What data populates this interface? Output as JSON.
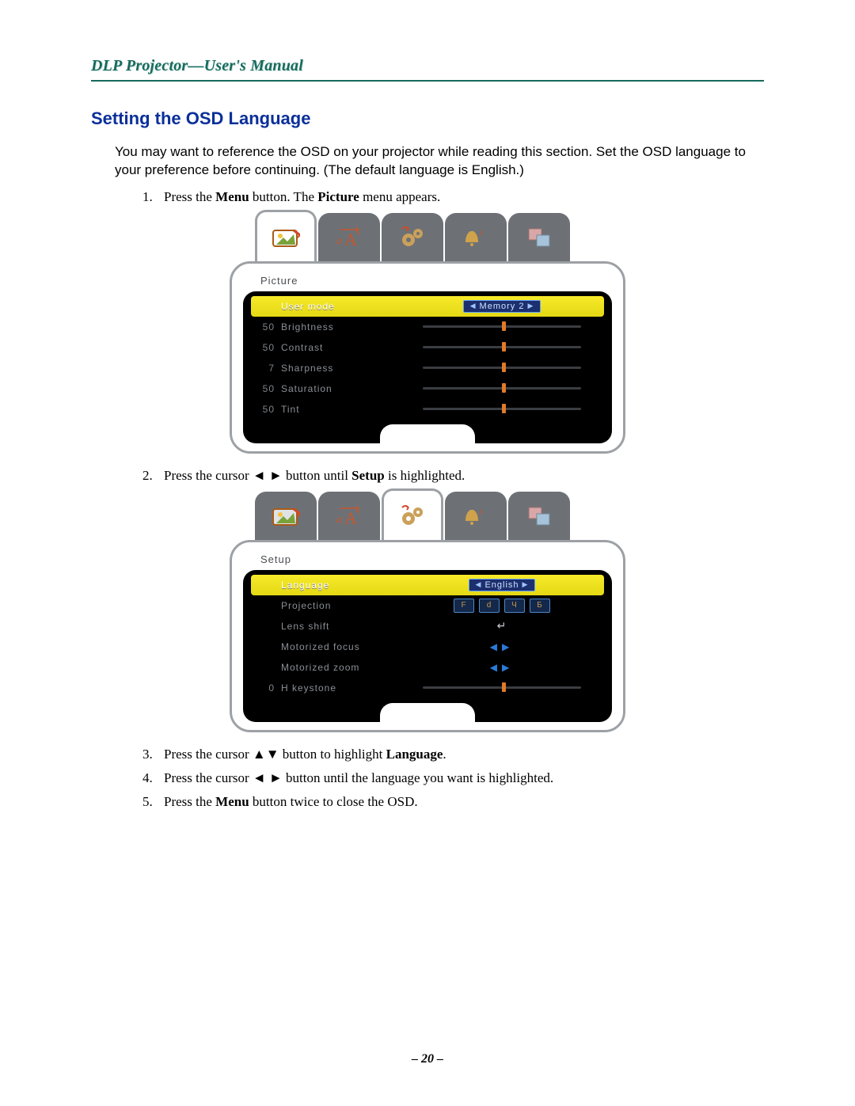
{
  "header": "DLP Projector—User's Manual",
  "heading": "Setting the OSD Language",
  "intro": "You may want to reference the OSD on your projector while reading this section. Set the OSD language to your preference before continuing. (The default language is English.)",
  "steps": {
    "s1_a": "Press the ",
    "s1_b1": "Menu",
    "s1_c": " button. The ",
    "s1_b2": "Picture",
    "s1_d": " menu appears.",
    "s2_a": "Press the cursor ◄ ► button until ",
    "s2_b": "Setup",
    "s2_c": " is highlighted.",
    "s3_a": "Press the cursor ▲▼ button to highlight ",
    "s3_b": "Language",
    "s3_c": ".",
    "s4_a": "Press the cursor ◄ ► button until the language you want is highlighted.",
    "s5_a": "Press the ",
    "s5_b": "Menu",
    "s5_c": " button twice to close the OSD."
  },
  "osd1": {
    "title": "Picture",
    "row_hl_label": "User mode",
    "row_hl_value": "Memory 2",
    "rows": [
      {
        "val": "50",
        "label": "Brightness",
        "pos": 50
      },
      {
        "val": "50",
        "label": "Contrast",
        "pos": 50
      },
      {
        "val": "7",
        "label": "Sharpness",
        "pos": 50
      },
      {
        "val": "50",
        "label": "Saturation",
        "pos": 50
      },
      {
        "val": "50",
        "label": "Tint",
        "pos": 50
      }
    ]
  },
  "osd2": {
    "title": "Setup",
    "row_hl_label": "Language",
    "row_hl_value": "English",
    "rows": [
      {
        "label": "Projection",
        "ctrl": "proj"
      },
      {
        "label": "Lens shift",
        "ctrl": "enter"
      },
      {
        "label": "Motorized focus",
        "ctrl": "lr"
      },
      {
        "label": "Motorized zoom",
        "ctrl": "lr"
      }
    ],
    "slider_row": {
      "val": "0",
      "label": "H keystone",
      "pos": 50
    },
    "proj_icons": [
      "F",
      "d",
      "Ч",
      "Б"
    ]
  },
  "page_num": "– 20 –",
  "tab_icons": {
    "picture": "picture-icon",
    "text": "text-aa-icon",
    "setup": "gears-icon",
    "music": "bell-music-icon",
    "pip": "pip-icon"
  }
}
